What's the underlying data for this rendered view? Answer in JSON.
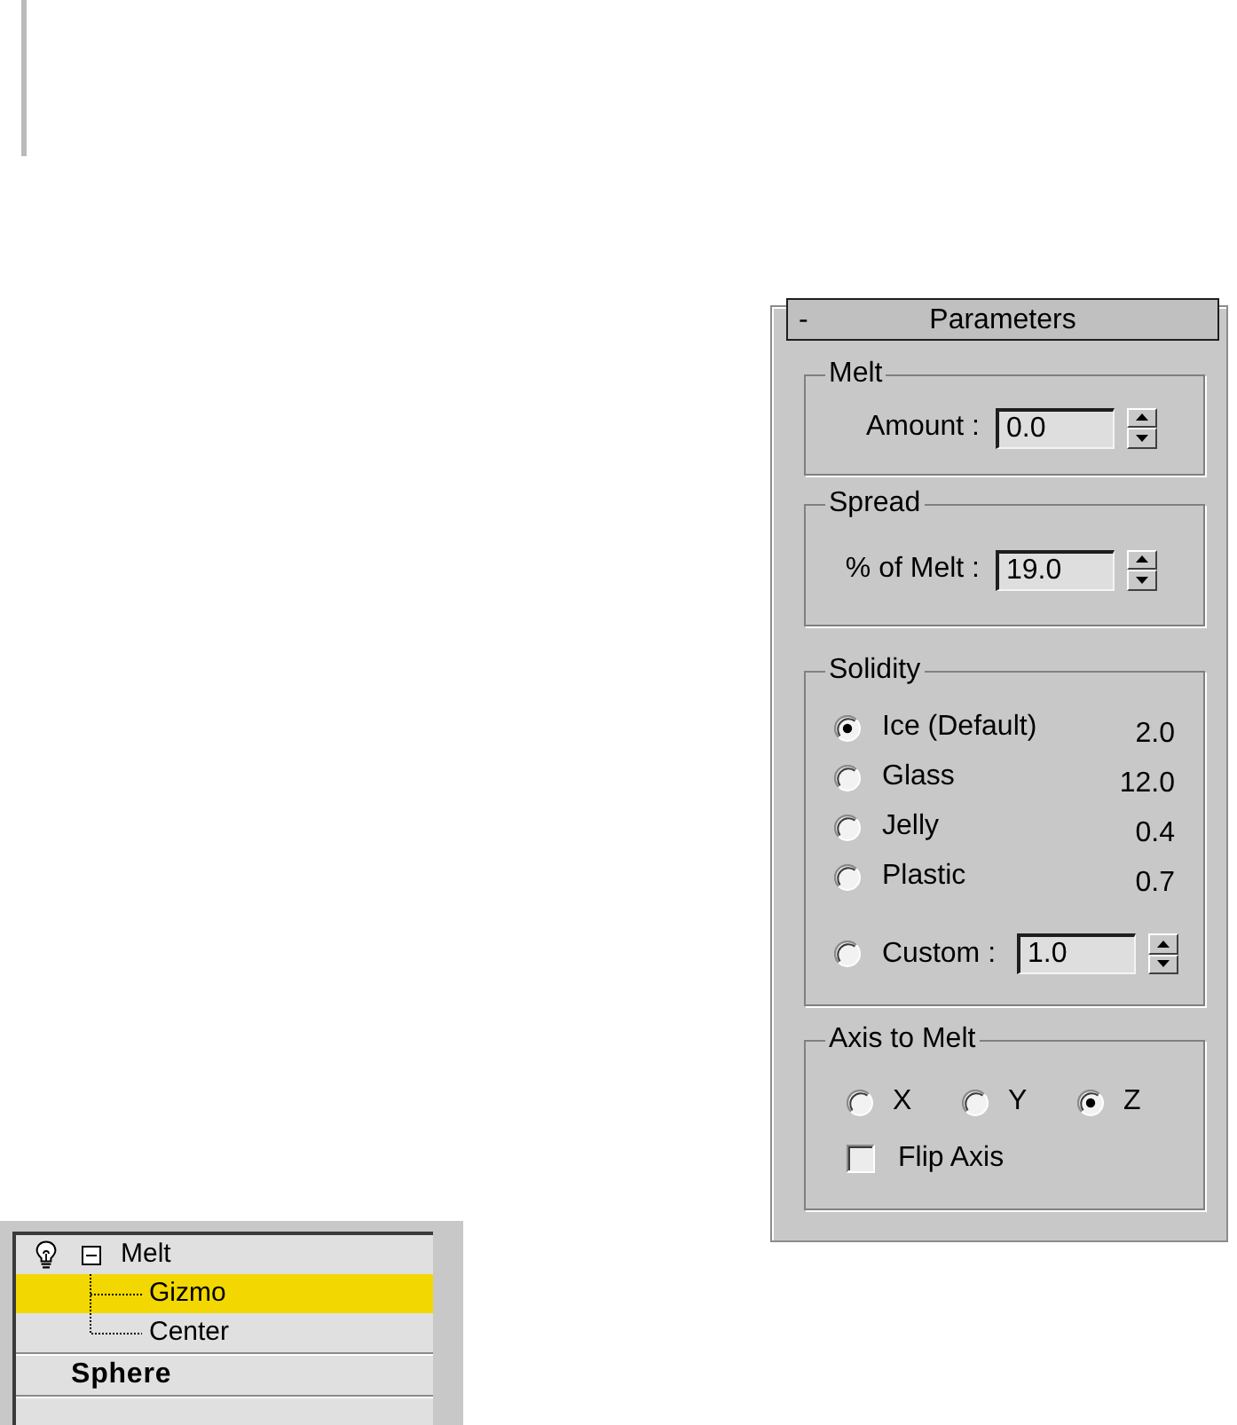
{
  "panel": {
    "collapse_symbol": "-",
    "title": "Parameters",
    "groups": [
      {
        "kind": "spinner",
        "title": "Melt",
        "label": "Amount :",
        "value": "0.0"
      },
      {
        "kind": "spinner",
        "title": "Spread",
        "label": "% of Melt :",
        "value": "19.0"
      },
      {
        "kind": "options",
        "title": "Solidity",
        "options": [
          {
            "kind": "preset",
            "label": "Ice (Default)",
            "value": "2.0",
            "selected": true
          },
          {
            "kind": "preset",
            "label": "Glass",
            "value": "12.0",
            "selected": false
          },
          {
            "kind": "preset",
            "label": "Jelly",
            "value": "0.4",
            "selected": false
          },
          {
            "kind": "preset",
            "label": "Plastic",
            "value": "0.7",
            "selected": false
          },
          {
            "kind": "custom",
            "label": "Custom :",
            "value": "1.0",
            "selected": false
          }
        ]
      },
      {
        "kind": "axis",
        "title": "Axis to Melt",
        "options": [
          {
            "label": "X",
            "selected": false
          },
          {
            "label": "Y",
            "selected": false
          },
          {
            "label": "Z",
            "selected": true
          }
        ],
        "checkbox": {
          "label": "Flip Axis",
          "checked": false
        }
      }
    ]
  },
  "modifier_stack": {
    "items": [
      {
        "kind": "modifier",
        "label": "Melt",
        "expanded": true,
        "selected": false,
        "children": [
          {
            "label": "Gizmo",
            "selected": true
          },
          {
            "label": "Center",
            "selected": false
          }
        ]
      },
      {
        "kind": "object",
        "label": "Sphere",
        "selected": false
      }
    ]
  }
}
